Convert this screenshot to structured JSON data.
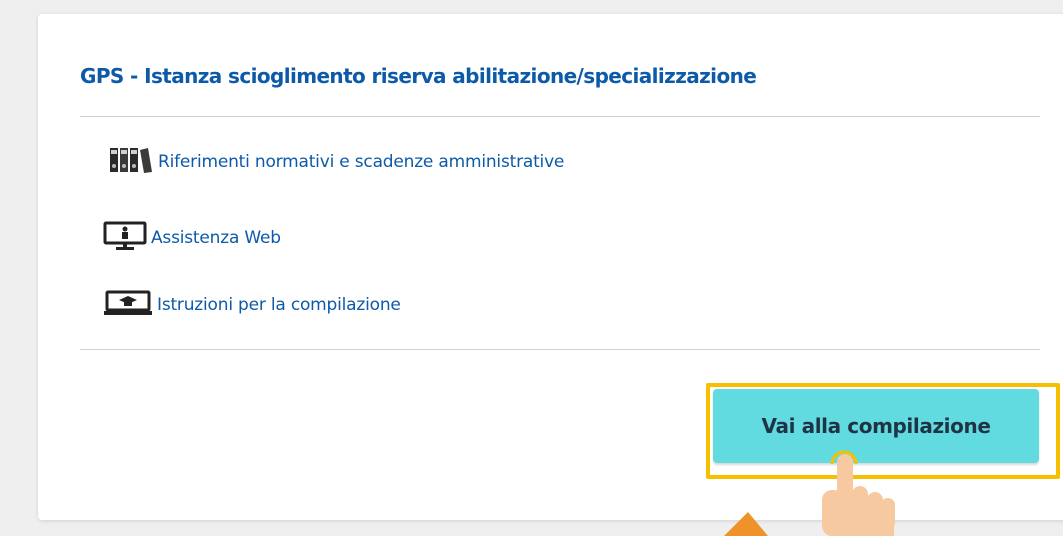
{
  "card": {
    "title": "GPS - Istanza scioglimento riserva abilitazione/specializzazione",
    "links": [
      {
        "label": "Riferimenti normativi e scadenze amministrative",
        "icon": "binders-icon"
      },
      {
        "label": "Assistenza Web",
        "icon": "web-assistance-monitor-icon"
      },
      {
        "label": "Istruzioni per la compilazione",
        "icon": "instructions-monitor-icon"
      }
    ],
    "action_label": "Vai alla compilazione"
  },
  "colors": {
    "title": "#0d5aa8",
    "link": "#0d5aa8",
    "button": "#62dbe0",
    "button_text": "#1e3445",
    "highlight": "#f6c000",
    "arrow": "#f0922a",
    "hand": "#f7c9a0"
  }
}
